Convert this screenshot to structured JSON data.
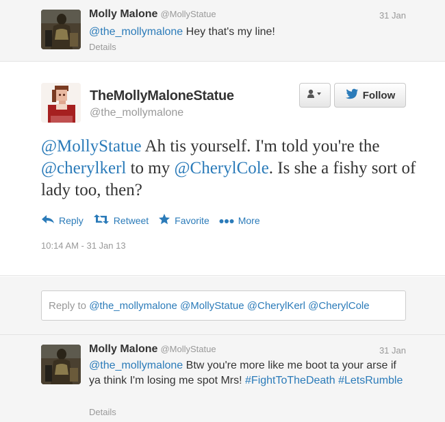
{
  "top_tweet": {
    "name": "Molly Malone",
    "handle": "@MollyStatue",
    "date": "31 Jan",
    "mention": "@the_mollymalone",
    "text": " Hey that's my line!",
    "details": "Details"
  },
  "main_tweet": {
    "name": "TheMollyMaloneStatue",
    "handle": "@the_mollymalone",
    "follow_label": "Follow",
    "text_parts": {
      "m1": "@MollyStatue",
      "t1": " Ah tis yourself. I'm told you're the ",
      "m2": "@cherylkerl",
      "t2": " to my ",
      "m3": "@CherylCole",
      "t3": ". Is she a fishy sort of lady too, then?"
    },
    "actions": {
      "reply": "Reply",
      "retweet": "Retweet",
      "favorite": "Favorite",
      "more": "More"
    },
    "timestamp": "10:14 AM - 31 Jan 13"
  },
  "reply_box": {
    "prefix": "Reply to ",
    "mentions": "@the_mollymalone @MollyStatue @CherylKerl @CherylCole"
  },
  "bottom_tweet": {
    "name": "Molly Malone",
    "handle": "@MollyStatue",
    "date": "31 Jan",
    "mention": "@the_mollymalone",
    "text": " Btw you're more like me boot ta your arse if ya think I'm losing me spot Mrs! ",
    "hashtag1": "#FightToTheDeath",
    "hashtag2": "#LetsRumble",
    "details": "Details"
  },
  "colors": {
    "link": "#2b7bb9",
    "muted": "#999999",
    "text": "#333333",
    "panel": "#f5f5f5"
  },
  "icons": [
    "statue-avatar",
    "pixel-avatar",
    "person-icon",
    "bird-icon",
    "reply-icon",
    "retweet-icon",
    "favorite-icon",
    "more-icon"
  ]
}
